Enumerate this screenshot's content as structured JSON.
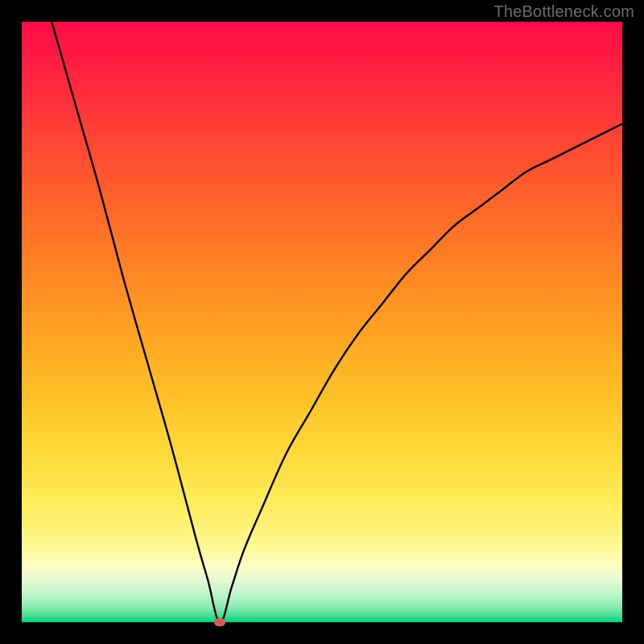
{
  "watermark": "TheBottleneck.com",
  "colors": {
    "watermark": "#6d6d6d",
    "curve_stroke": "#000000",
    "marker_fill": "#d65a5a",
    "frame": "#000000"
  },
  "chart_data": {
    "type": "line",
    "title": "",
    "xlabel": "",
    "ylabel": "",
    "xlim": [
      0,
      100
    ],
    "ylim": [
      0,
      100
    ],
    "marker": {
      "x": 33,
      "y": 0
    },
    "series": [
      {
        "name": "bottleneck-curve",
        "x": [
          5,
          9,
          13,
          17,
          21,
          25,
          29,
          31,
          33,
          35,
          37,
          40,
          44,
          48,
          52,
          56,
          60,
          64,
          68,
          72,
          76,
          80,
          84,
          88,
          92,
          96,
          100
        ],
        "values": [
          100,
          86,
          72,
          57,
          43,
          29,
          14,
          7,
          0,
          6,
          12,
          19,
          28,
          35,
          42,
          48,
          53,
          58,
          62,
          66,
          69,
          72,
          75,
          77,
          79,
          81,
          83
        ]
      }
    ],
    "gradient_stops": [
      {
        "pos": 0.0,
        "color": "#ff0d45"
      },
      {
        "pos": 0.5,
        "color": "#ff9822"
      },
      {
        "pos": 0.85,
        "color": "#fff376"
      },
      {
        "pos": 1.0,
        "color": "#00d277"
      }
    ]
  }
}
